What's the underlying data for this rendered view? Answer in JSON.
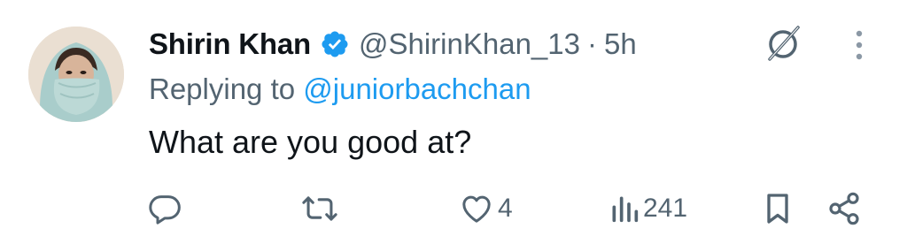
{
  "tweet": {
    "author": {
      "display_name": "Shirin Khan",
      "handle": "@ShirinKhan_13",
      "verified": true,
      "avatar": "avatar-photo-woman-headscarf"
    },
    "separator": "·",
    "timestamp": "5h",
    "reply_prefix": "Replying to ",
    "reply_to": "@juniorbachchan",
    "text": "What are you good at?",
    "actions": {
      "reply": {
        "icon": "reply-icon",
        "count": ""
      },
      "retweet": {
        "icon": "retweet-icon",
        "count": ""
      },
      "like": {
        "icon": "heart-icon",
        "count": "4"
      },
      "views": {
        "icon": "views-icon",
        "count": "241"
      },
      "bookmark": {
        "icon": "bookmark-icon"
      },
      "share": {
        "icon": "share-icon"
      }
    },
    "header_icons": [
      "grok-icon",
      "more-icon"
    ]
  },
  "colors": {
    "text_primary": "#0f1419",
    "text_secondary": "#536471",
    "accent_blue": "#1d9bf0"
  }
}
